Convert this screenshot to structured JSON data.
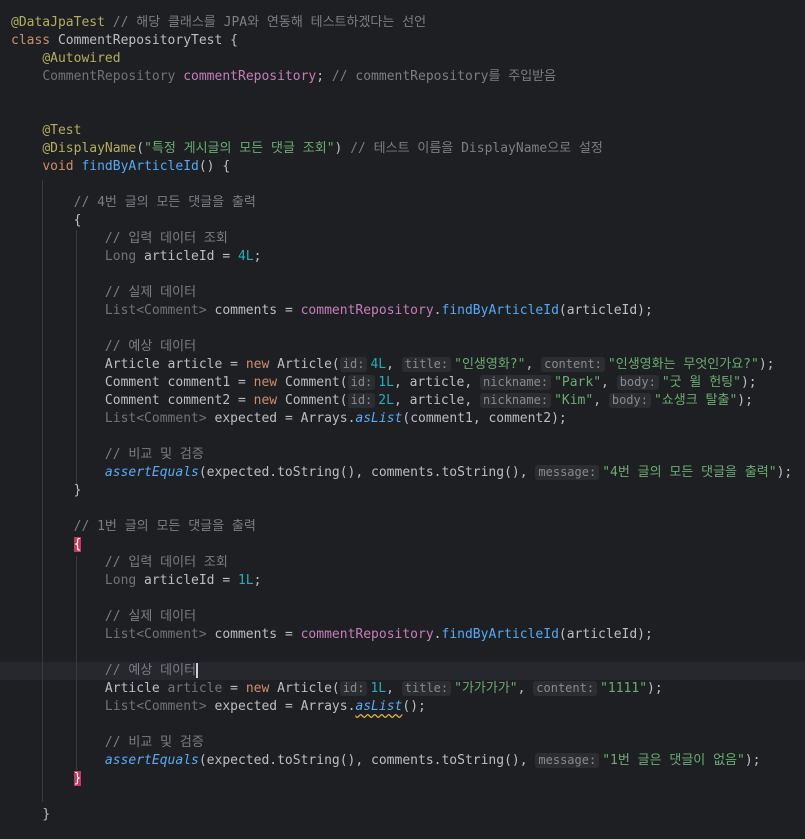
{
  "line_data_jpa_test": {
    "ann": "@DataJpaTest",
    "comment": " // 해당 클래스를 JPA와 연동해 테스트하겠다는 선언"
  },
  "line_class": {
    "kw": "class",
    "name": " CommentRepositoryTest {"
  },
  "line_autowired": {
    "ann": "@Autowired"
  },
  "line_field_decl": {
    "type": "CommentRepository",
    "name": "commentRepository",
    "semi": ";",
    "comment": " // commentRepository를 주입받음"
  },
  "line_test_ann": {
    "ann": "@Test"
  },
  "line_display_name": {
    "ann": "@DisplayName",
    "open": "(",
    "str": "\"특정 게시글의 모든 댓글 조회\"",
    "close": ")",
    "comment": " // 테스트 이름을 DisplayName으로 설정"
  },
  "line_method_decl": {
    "kw": "void",
    "name": "findByArticleId",
    "rest": "() {"
  },
  "block1_comment": "// 4번 글의 모든 댓글을 출력",
  "block1_open_brace": "{",
  "b1_input_comment": "// 입력 데이터 조회",
  "b1_article_id": {
    "type": "Long",
    "var": " articleId = ",
    "num": "4L",
    "semi": ";"
  },
  "b1_actual_comment": "// 실제 데이터",
  "b1_actual": {
    "type": "List<Comment>",
    "var": "comments",
    "eq": " = ",
    "repo": "commentRepository",
    "dot": ".",
    "method": "findByArticleId",
    "args": "(articleId);"
  },
  "b1_expected_comment": "// 예상 데이터",
  "b1_article": {
    "type": "Article",
    "var": "article",
    "eq": " = ",
    "new": "new",
    "ctor": " Article(",
    "hint_id": "id:",
    "id": "4L",
    "comma1": ", ",
    "hint_title": "title:",
    "title": "\"인생영화?\"",
    "comma2": ", ",
    "hint_content": "content:",
    "content": "\"인생영화는 무엇인가요?\"",
    "end": ");"
  },
  "b1_comment1": {
    "type": "Comment",
    "var": "comment1",
    "eq": " = ",
    "new": "new",
    "ctor": " Comment(",
    "hint_id": "id:",
    "id": "1L",
    "mid": ", article, ",
    "hint_nick": "nickname:",
    "nick": "\"Park\"",
    "comma": ", ",
    "hint_body": "body:",
    "body": "\"굿 윌 헌팅\"",
    "end": ");"
  },
  "b1_comment2": {
    "type": "Comment",
    "var": "comment2",
    "eq": " = ",
    "new": "new",
    "ctor": " Comment(",
    "hint_id": "id:",
    "id": "2L",
    "mid": ", article, ",
    "hint_nick": "nickname:",
    "nick": "\"Kim\"",
    "comma": ", ",
    "hint_body": "body:",
    "body": "\"쇼생크 탈출\"",
    "end": ");"
  },
  "b1_expected": {
    "type": "List<Comment>",
    "var": "expected",
    "eq": " = Arrays.",
    "static": "asList",
    "args": "(comment1, comment2);"
  },
  "b1_compare_comment": "// 비교 및 검증",
  "b1_assert": {
    "static": "assertEquals",
    "args1": "(expected.toString(), comments.toString(), ",
    "hint_msg": "message:",
    "msg": "\"4번 글의 모든 댓글을 출력\"",
    "end": ");"
  },
  "block1_close_brace": "}",
  "block2_comment": "// 1번 글의 모든 댓글을 출력",
  "block2_open_brace": "{",
  "b2_input_comment": "// 입력 데이터 조회",
  "b2_article_id": {
    "type": "Long",
    "var": " articleId = ",
    "num": "1L",
    "semi": ";"
  },
  "b2_actual_comment": "// 실제 데이터",
  "b2_actual": {
    "type": "List<Comment>",
    "var": "comments",
    "eq": " = ",
    "repo": "commentRepository",
    "dot": ".",
    "method": "findByArticleId",
    "args": "(articleId);"
  },
  "b2_expected_comment": "// 예상 데이터",
  "b2_article": {
    "type": "Article",
    "var": "article",
    "eq": " = ",
    "new": "new",
    "ctor": " Article(",
    "hint_id": "id:",
    "id": "1L",
    "comma1": ", ",
    "hint_title": "title:",
    "title": "\"가가가가\"",
    "comma2": ", ",
    "hint_content": "content:",
    "content": "\"1111\"",
    "end": ");"
  },
  "b2_expected": {
    "type": "List<Comment>",
    "var": "expected",
    "eq": " = Arrays.",
    "static": "asList",
    "args": "();"
  },
  "b2_compare_comment": "// 비교 및 검증",
  "b2_assert": {
    "static": "assertEquals",
    "args1": "(expected.toString(), comments.toString(), ",
    "hint_msg": "message:",
    "msg": "\"1번 글은 댓글이 없음\"",
    "end": ");"
  },
  "block2_close_brace": "}",
  "method_close_brace": "}"
}
